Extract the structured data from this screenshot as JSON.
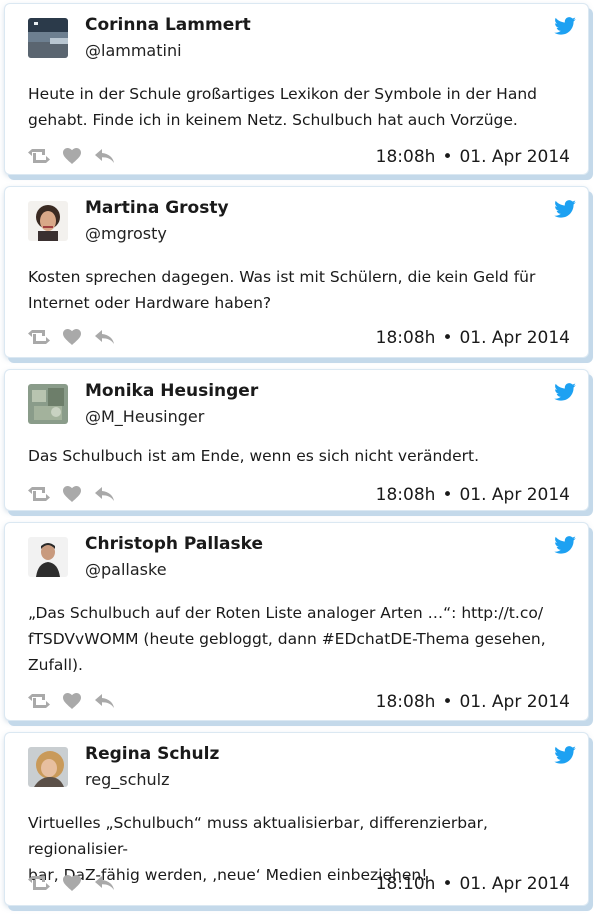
{
  "colors": {
    "twitter_blue": "#1da1f2",
    "action_gray": "#a9a9a9",
    "card_shadow": "#c4d9ea"
  },
  "icons": {
    "brand": "twitter-bird-icon",
    "retweet": "retweet-icon",
    "like": "heart-icon",
    "reply": "reply-icon"
  },
  "separator": "•",
  "tweets": [
    {
      "name": "Corinna Lammert",
      "handle": "@lammatini",
      "text_lines": [
        "Heute in der Schule großartiges Lexikon der Symbole in der Hand",
        "gehabt. Finde ich in keinem Netz. Schulbuch hat auch Vorzüge."
      ],
      "time": "18:08h",
      "date": "01. Apr 2014"
    },
    {
      "name": "Martina Grosty",
      "handle": "@mgrosty",
      "text_lines": [
        "Kosten sprechen dagegen. Was ist mit Schülern, die kein Geld für",
        "Internet oder Hardware haben?"
      ],
      "time": "18:08h",
      "date": "01. Apr 2014"
    },
    {
      "name": "Monika Heusinger",
      "handle": "@M_Heusinger",
      "text_lines": [
        "Das Schulbuch ist am Ende, wenn es sich nicht verändert."
      ],
      "time": "18:08h",
      "date": "01. Apr 2014"
    },
    {
      "name": "Christoph Pallaske",
      "handle": "@pallaske",
      "text_lines": [
        "„Das Schulbuch auf der Roten Liste analoger Arten …“: http://t.co/",
        "fTSDVvWOMM (heute gebloggt, dann #EDchatDE-Thema gesehen,",
        "Zufall)."
      ],
      "time": "18:08h",
      "date": "01. Apr 2014"
    },
    {
      "name": "Regina Schulz",
      "handle": "reg_schulz",
      "text_lines": [
        "Virtuelles „Schulbuch“ muss aktualisierbar, differenzierbar, regionalisier-",
        "bar, DaZ-fähig werden, ‚neue‘ Medien einbeziehen!"
      ],
      "time": "18:10h",
      "date": "01. Apr 2014"
    }
  ]
}
